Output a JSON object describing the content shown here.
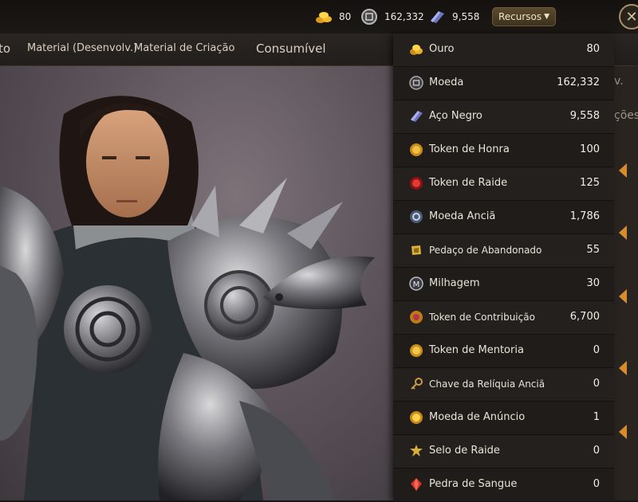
{
  "topbar": {
    "gold": "80",
    "coin": "162,332",
    "steel": "9,558",
    "dropdown_label": "Recursos",
    "close_label": "✕"
  },
  "tabs": [
    {
      "label": "to"
    },
    {
      "label": "Material (Desenvolv.)"
    },
    {
      "label": "Material de Criação"
    },
    {
      "label": "Consumível"
    }
  ],
  "side": {
    "text1": "v.",
    "text2": "ções"
  },
  "resources": [
    {
      "name": "Ouro",
      "value": "80",
      "icon": "gold-coins-icon",
      "color": "#e3b02a"
    },
    {
      "name": "Moeda",
      "value": "162,332",
      "icon": "coin-icon",
      "color": "#9a9aa0"
    },
    {
      "name": "Aço Negro",
      "value": "9,558",
      "icon": "black-steel-icon",
      "color": "#7f86c9"
    },
    {
      "name": "Token de Honra",
      "value": "100",
      "icon": "honor-token-icon",
      "color": "#e0a82a"
    },
    {
      "name": "Token de Raide",
      "value": "125",
      "icon": "raid-token-icon",
      "color": "#d3272b"
    },
    {
      "name": "Moeda Anciã",
      "value": "1,786",
      "icon": "ancient-coin-icon",
      "color": "#8fa7c4"
    },
    {
      "name": "Pedaço de Abandonado",
      "value": "55",
      "icon": "abandoned-piece-icon",
      "color": "#d8b03a"
    },
    {
      "name": "Milhagem",
      "value": "30",
      "icon": "mileage-icon",
      "color": "#b9bcc4"
    },
    {
      "name": "Token de Contribuição",
      "value": "6,700",
      "icon": "contribution-token-icon",
      "color": "#e0a02c"
    },
    {
      "name": "Token de Mentoria",
      "value": "0",
      "icon": "mentor-token-icon",
      "color": "#e2b236"
    },
    {
      "name": "Chave da Relíquia Anciã",
      "value": "0",
      "icon": "relic-key-icon",
      "color": "#c99a4a"
    },
    {
      "name": "Moeda de Anúncio",
      "value": "1",
      "icon": "ad-coin-icon",
      "color": "#e6b02e"
    },
    {
      "name": "Selo de Raide",
      "value": "0",
      "icon": "raid-seal-icon",
      "color": "#d9ad38"
    },
    {
      "name": "Pedra de Sangue",
      "value": "0",
      "icon": "blood-stone-icon",
      "color": "#d8302a"
    }
  ]
}
